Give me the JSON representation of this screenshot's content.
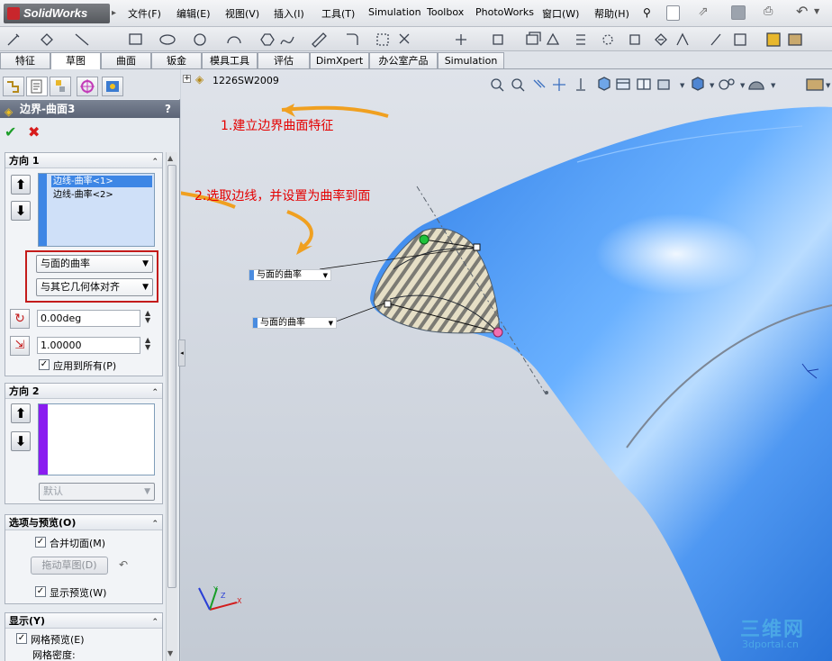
{
  "app": {
    "name": "SolidWorks"
  },
  "menu": [
    "文件(F)",
    "编辑(E)",
    "视图(V)",
    "插入(I)",
    "工具(T)",
    "Simulation",
    "Toolbox",
    "PhotoWorks",
    "窗口(W)",
    "帮助(H)"
  ],
  "command_tabs": [
    "特征",
    "草图",
    "曲面",
    "钣金",
    "模具工具",
    "评估",
    "DimXpert",
    "办公室产品",
    "Simulation"
  ],
  "active_tab": "草图",
  "feature": {
    "title": "边界-曲面3",
    "help": "?"
  },
  "direction1": {
    "title": "方向 1",
    "items": [
      "边线-曲率<1>",
      "边线-曲率<2>"
    ],
    "condition": "与面的曲率",
    "alignment": "与其它几何体对齐",
    "angle": "0.00deg",
    "magnitude": "1.00000",
    "apply_all": "应用到所有(P)"
  },
  "direction2": {
    "title": "方向 2",
    "default_option": "默认"
  },
  "options": {
    "title": "选项与预览(O)",
    "merge": "合并切面(M)",
    "drag_button": "拖动草图(D)",
    "show_preview": "显示预览(W)"
  },
  "display": {
    "title": "显示(Y)",
    "mesh_preview": "网格预览(E)",
    "mesh_density": "网格密度:"
  },
  "tree_root": "1226SW2009",
  "annotations": {
    "step1": "1.建立边界曲面特征",
    "step2": "2.选取边线，并设置为曲率到面"
  },
  "callouts": [
    "与面的曲率",
    "与面的曲率"
  ],
  "triad": {
    "x": "X",
    "y": "Y",
    "z": "Z"
  },
  "watermark": {
    "main": "三维网",
    "sub": "3dportal.cn"
  },
  "colors": {
    "accent": "#3d86e5",
    "annotation": "#e40000",
    "arrow": "#f0a020",
    "surface": "#3f8ff0"
  }
}
